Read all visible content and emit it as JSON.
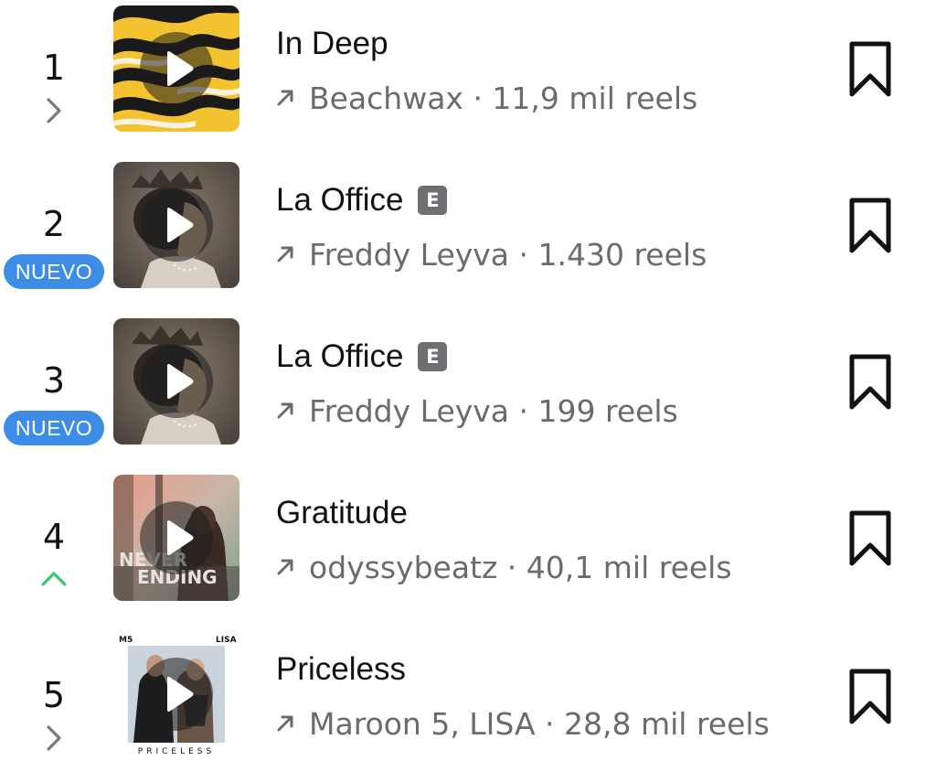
{
  "tracks": [
    {
      "rank": "1",
      "trend": "same",
      "badge": "",
      "title": "In Deep",
      "explicit": false,
      "meta": "Beachwax · 11,9 mil reels",
      "cover_text": []
    },
    {
      "rank": "2",
      "trend": "new",
      "badge": "NUEVO",
      "title": "La Office",
      "explicit": true,
      "explicit_label": "E",
      "meta": "Freddy Leyva · 1.430 reels",
      "cover_text": []
    },
    {
      "rank": "3",
      "trend": "new",
      "badge": "NUEVO",
      "title": "La Office",
      "explicit": true,
      "explicit_label": "E",
      "meta": "Freddy Leyva · 199 reels",
      "cover_text": []
    },
    {
      "rank": "4",
      "trend": "up",
      "badge": "",
      "title": "Gratitude",
      "explicit": false,
      "meta": "odyssybeatz · 40,1 mil reels",
      "cover_text": [
        "NEVER",
        "ENDING"
      ]
    },
    {
      "rank": "5",
      "trend": "same",
      "badge": "",
      "title": "Priceless",
      "explicit": false,
      "meta": "Maroon 5, LISA · 28,8 mil reels",
      "cover_text": [
        "M5",
        "LISA",
        "PRICELESS"
      ]
    }
  ],
  "icons": {
    "trend_same": "chevron-right-icon",
    "trend_up": "chevron-up-icon",
    "meta_arrow": "arrow-up-right-icon",
    "save": "bookmark-icon",
    "play": "play-icon"
  },
  "colors": {
    "badge": "#3d8de6",
    "trend_up": "#3ec56b",
    "meta_text": "#6b6b6b",
    "explicit": "#6e6e73"
  }
}
